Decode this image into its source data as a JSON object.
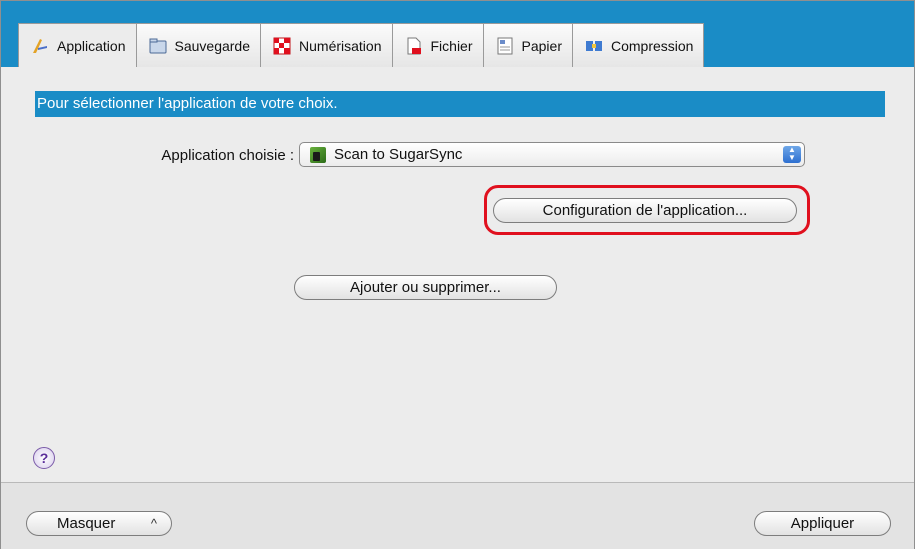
{
  "tabs": [
    {
      "label": "Application",
      "icon": "application-icon",
      "active": true
    },
    {
      "label": "Sauvegarde",
      "icon": "folder-icon",
      "active": false
    },
    {
      "label": "Numérisation",
      "icon": "scan-icon",
      "active": false
    },
    {
      "label": "Fichier",
      "icon": "file-icon",
      "active": false
    },
    {
      "label": "Papier",
      "icon": "paper-icon",
      "active": false
    },
    {
      "label": "Compression",
      "icon": "compression-icon",
      "active": false
    }
  ],
  "banner": {
    "text": "Pour sélectionner l'application de votre choix."
  },
  "application": {
    "label": "Application choisie :",
    "selected": "Scan to SugarSync",
    "selected_icon": "sugarsync-icon"
  },
  "buttons": {
    "configure": "Configuration de l'application...",
    "add_remove": "Ajouter ou supprimer...",
    "hide": "Masquer",
    "apply": "Appliquer",
    "help": "?"
  },
  "colors": {
    "accent": "#1a8cc6",
    "highlight": "#e0101e"
  }
}
